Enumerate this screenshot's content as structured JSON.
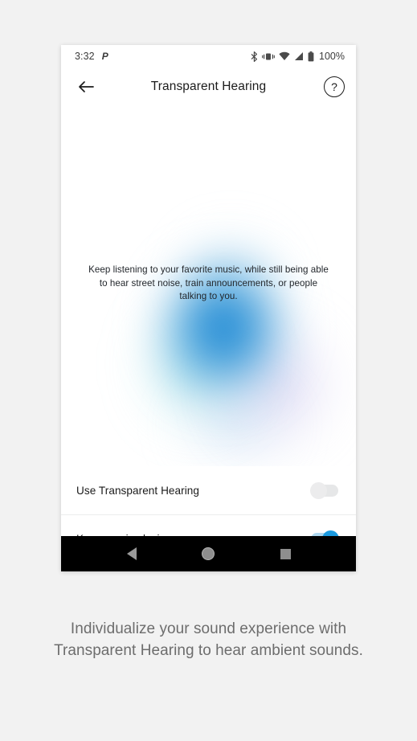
{
  "status_bar": {
    "time": "3:32",
    "app_icon": "P",
    "icons": [
      "bluetooth-icon",
      "vibrate-icon",
      "wifi-icon",
      "cellular-signal-icon",
      "battery-icon"
    ],
    "battery_percent": "100%"
  },
  "app_bar": {
    "back_label": "←",
    "title": "Transparent Hearing",
    "help_label": "?"
  },
  "hero": {
    "description": "Keep listening to your favorite music, while still being able to hear street noise, train announcements, or people talking to you.",
    "colors": {
      "core_blue": "#1b87d2",
      "cyan": "#78d6e0",
      "lavender": "#bab0e8"
    }
  },
  "settings": {
    "rows": [
      {
        "label": "Use Transparent Hearing",
        "state": "off"
      },
      {
        "label": "Keep music playing",
        "state": "on"
      }
    ]
  },
  "nav_bar": {
    "back": "back-icon",
    "home": "home-icon",
    "recents": "recents-icon"
  },
  "caption": {
    "text": "Individualize your sound experience with Transparent Hearing to hear ambient sounds."
  }
}
